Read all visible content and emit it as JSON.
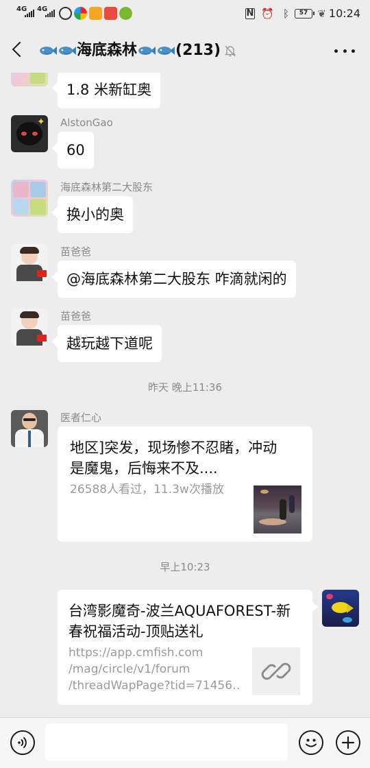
{
  "status_bar": {
    "network_1": "4G",
    "network_2": "4G",
    "battery": "57",
    "time": "10:24"
  },
  "header": {
    "title": "海底森林",
    "member_count": "(213)",
    "icons": [
      "back-icon",
      "fish-icon",
      "mute-bell-icon",
      "more-icon"
    ]
  },
  "messages": [
    {
      "sender": "",
      "text": "1.8 米新缸奥"
    },
    {
      "sender": "AlstonGao",
      "text": "60"
    },
    {
      "sender": "海底森林第二大股东",
      "text": "换小的奥"
    },
    {
      "sender": "苗爸爸",
      "text": "@海底森林第二大股东  咋滴就闲的"
    },
    {
      "sender": "苗爸爸",
      "text": "越玩越下道呢"
    }
  ],
  "timestamp_1": "昨天 晚上11:36",
  "video_card": {
    "sender": "医者仁心",
    "title_line1": "地区]突发，现场惨不忍睹，冲动",
    "title_line2": "是魔鬼，后悔来不及....",
    "stats": "26588人看过，11.3w次播放"
  },
  "timestamp_2": "早上10:23",
  "link_card": {
    "title_line1": "台湾影魔奇-波兰AQUAFOREST-新",
    "title_line2": "春祝福活动-顶贴送礼",
    "url_line1": "https://app.cmfish.com",
    "url_line2": "/mag/circle/v1/forum",
    "url_line3": "/threadWapPage?tid=71456…"
  },
  "input_bar": {
    "placeholder": "",
    "icons": [
      "voice-icon",
      "emoji-icon",
      "plus-icon"
    ]
  },
  "colors": {
    "background": "#ededed",
    "bubble": "#ffffff",
    "meta_text": "#8a8a8a"
  }
}
